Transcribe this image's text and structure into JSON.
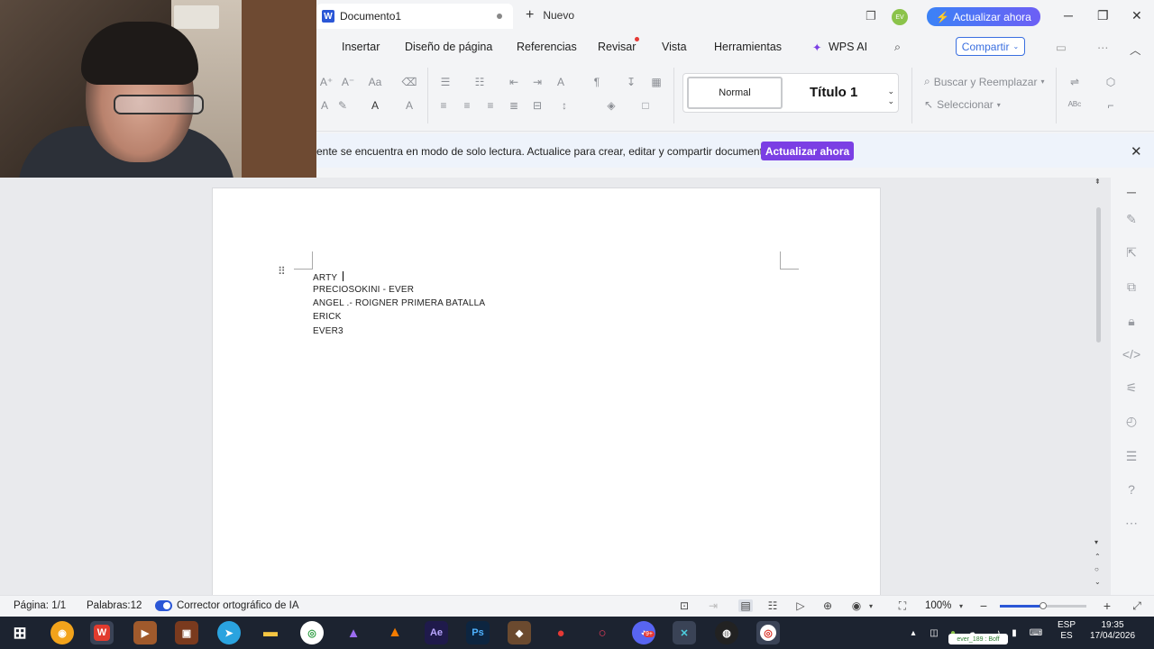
{
  "titlebar": {
    "doc_tab_title": "Documento1",
    "new_tab_label": "Nuevo",
    "avatar_initials": "EV",
    "upgrade_label": "Actualizar ahora"
  },
  "ribbon": {
    "tabs": [
      "Insertar",
      "Diseño de página",
      "Referencias",
      "Revisar",
      "Vista",
      "Herramientas"
    ],
    "wps_ai_label": "WPS AI",
    "share_label": "Compartir"
  },
  "toolbar": {
    "style_normal": "Normal",
    "style_title1": "Título 1",
    "find_replace_label": "Buscar y Reemplazar",
    "select_label": "Seleccionar"
  },
  "notice": {
    "message": "ente se encuentra en modo de solo lectura. Actualice para crear, editar y compartir documentos.",
    "upgrade_label": "Actualizar ahora"
  },
  "document": {
    "lines": [
      "ARTY",
      "PRECIOSOKINI - EVER",
      "ANGEL .- ROIGNER PRIMERA BATALLA",
      "ERICK",
      "EVER3"
    ]
  },
  "statusbar": {
    "page": "Página: 1/1",
    "words": "Palabras:12",
    "spellcheck_label": "Corrector ortográfico de IA",
    "zoom": "100%",
    "zoom_level": 0.5
  },
  "taskbar": {
    "lang_top": "ESP",
    "lang_bottom": "ES",
    "time": "19:35",
    "date": "17/04/2026",
    "tray_pill": "ever_189 : Boff",
    "chat_badge": "9+"
  },
  "colors": {
    "accent": "#2b57d6",
    "upgrade_purple": "#7b3fe4",
    "notice_bg": "#eef3fb"
  }
}
